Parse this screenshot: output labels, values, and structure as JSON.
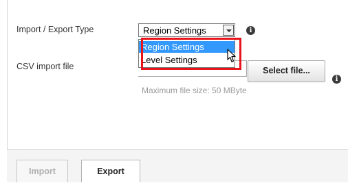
{
  "form": {
    "type_label": "Import / Export Type",
    "type_value": "Region Settings",
    "type_options": [
      "Region Settings",
      "Level Settings"
    ],
    "csv_label": "CSV import file",
    "file_value": "",
    "select_file_label": "Select file...",
    "hint": "Maximum file size: 50 MByte",
    "info_icon": "info-icon"
  },
  "footer": {
    "import_label": "Import",
    "export_label": "Export"
  },
  "colors": {
    "highlight": "#e8141c",
    "option_selected": "#3399ff"
  }
}
